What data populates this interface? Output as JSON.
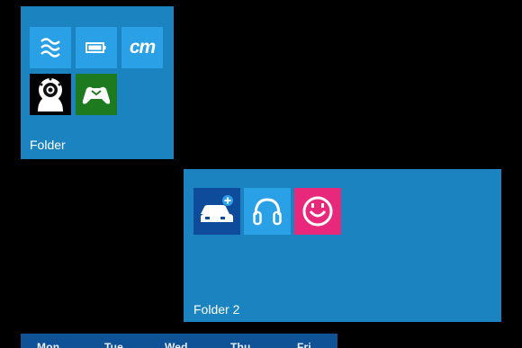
{
  "folders": [
    {
      "name": "Folder",
      "tiles": [
        {
          "icon": "waves-icon",
          "bg": "#2aa0e6"
        },
        {
          "icon": "battery-icon",
          "bg": "#2aa0e6"
        },
        {
          "icon": "cm-app-icon",
          "text": "cm",
          "bg": "#2aa0e6"
        },
        {
          "icon": "webcam-icon",
          "bg": "#ffffff"
        },
        {
          "icon": "xbox-icon",
          "bg": "#1e7a1e"
        }
      ]
    },
    {
      "name": "Folder 2",
      "tiles": [
        {
          "icon": "car-add-icon",
          "bg": "#0e4b9a"
        },
        {
          "icon": "headphones-icon",
          "bg": "#2aa0e6"
        },
        {
          "icon": "smiley-icon",
          "bg": "#e8297b"
        }
      ]
    }
  ],
  "calendar": {
    "days": [
      "Mon",
      "Tue",
      "Wed",
      "Thu",
      "Fri"
    ]
  },
  "colors": {
    "background": "#000000",
    "folder_bg": "#1b84c0",
    "tile_blue": "#2aa0e6",
    "calendar_bg": "#0f5296"
  }
}
